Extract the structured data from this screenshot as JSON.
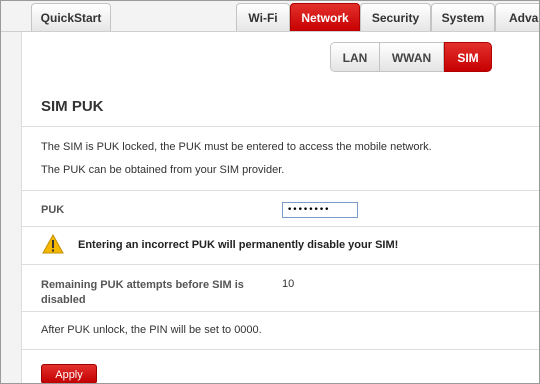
{
  "nav": {
    "quickstart": "QuickStart",
    "tabs": [
      "Wi-Fi",
      "Network",
      "Security",
      "System",
      "Advanced"
    ],
    "active_tab": "Network"
  },
  "subnav": {
    "tabs": [
      "LAN",
      "WWAN",
      "SIM"
    ],
    "active_tab": "SIM"
  },
  "page": {
    "title": "SIM PUK",
    "info_line1": "The SIM is PUK locked, the PUK must be entered to access the mobile network.",
    "info_line2": "The PUK can be obtained from your SIM provider.",
    "puk_label": "PUK",
    "puk_value": "••••••••",
    "warning": "Entering an incorrect PUK will permanently disable your SIM!",
    "remaining_label": "Remaining PUK attempts before SIM is disabled",
    "remaining_value": "10",
    "after_unlock": "After PUK unlock, the PIN will be set to 0000.",
    "apply_label": "Apply"
  },
  "colors": {
    "accent_red": "#c60000",
    "warning_yellow": "#f5b800"
  }
}
